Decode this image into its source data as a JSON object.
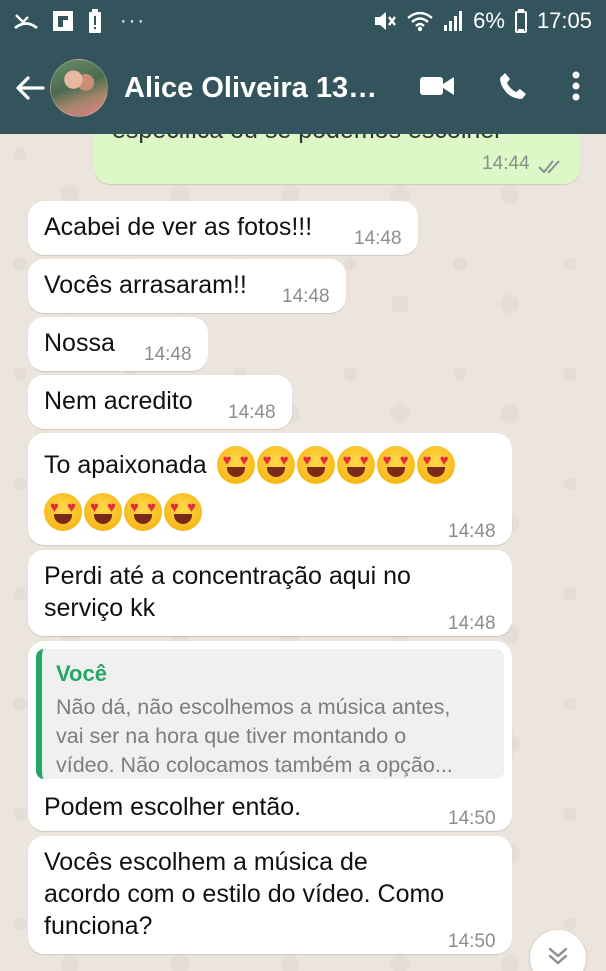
{
  "status_bar": {
    "battery": "6%",
    "time": "17:05",
    "more": "···"
  },
  "header": {
    "contact_name": "Alice Oliveira 13/..."
  },
  "messages": [
    {
      "text": "especifica ou se podemos escolher",
      "time": "14:44"
    },
    {
      "text": "Acabei de ver as fotos!!!",
      "time": "14:48"
    },
    {
      "text": "Vocês arrasaram!!",
      "time": "14:48"
    },
    {
      "text": "Nossa",
      "time": "14:48"
    },
    {
      "text": "Nem acredito",
      "time": "14:48"
    },
    {
      "text": "To apaixonada",
      "time": "14:48"
    },
    {
      "text_line1": "Perdi até a concentração aqui no",
      "text_line2": "serviço kk",
      "time": "14:48"
    },
    {
      "quote_author": "Você",
      "quote_line1": "Não dá, não escolhemos a música antes,",
      "quote_line2": "vai ser na hora que tiver montando o",
      "quote_line3": "vídeo. Não colocamos também a opção...",
      "text": "Podem escolher então.",
      "time": "14:50"
    },
    {
      "text_line1": "Vocês escolhem a música de",
      "text_line2": "acordo com o estilo do vídeo. Como",
      "text_line3": "funciona?",
      "time": "14:50"
    }
  ]
}
